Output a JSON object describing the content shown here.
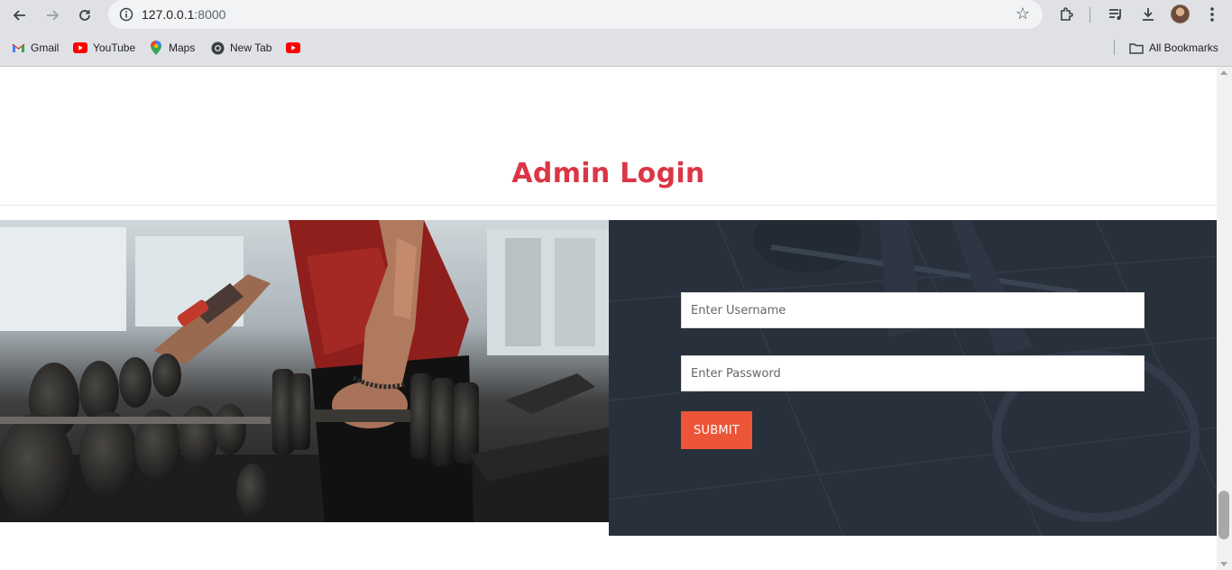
{
  "browser": {
    "url_host": "127.0.0.1",
    "url_port": ":8000",
    "bookmarks": [
      {
        "label": "Gmail",
        "icon": "gmail-icon"
      },
      {
        "label": "YouTube",
        "icon": "youtube-icon"
      },
      {
        "label": "Maps",
        "icon": "maps-icon"
      },
      {
        "label": "New Tab",
        "icon": "chrome-icon"
      },
      {
        "label": "",
        "icon": "youtube-icon"
      }
    ],
    "all_bookmarks_label": "All Bookmarks"
  },
  "page": {
    "title": "Admin Login",
    "title_color": "#dc3545",
    "form": {
      "username_placeholder": "Enter Username",
      "password_placeholder": "Enter Password",
      "submit_label": "SUBMIT",
      "submit_color": "#ec5538"
    }
  }
}
